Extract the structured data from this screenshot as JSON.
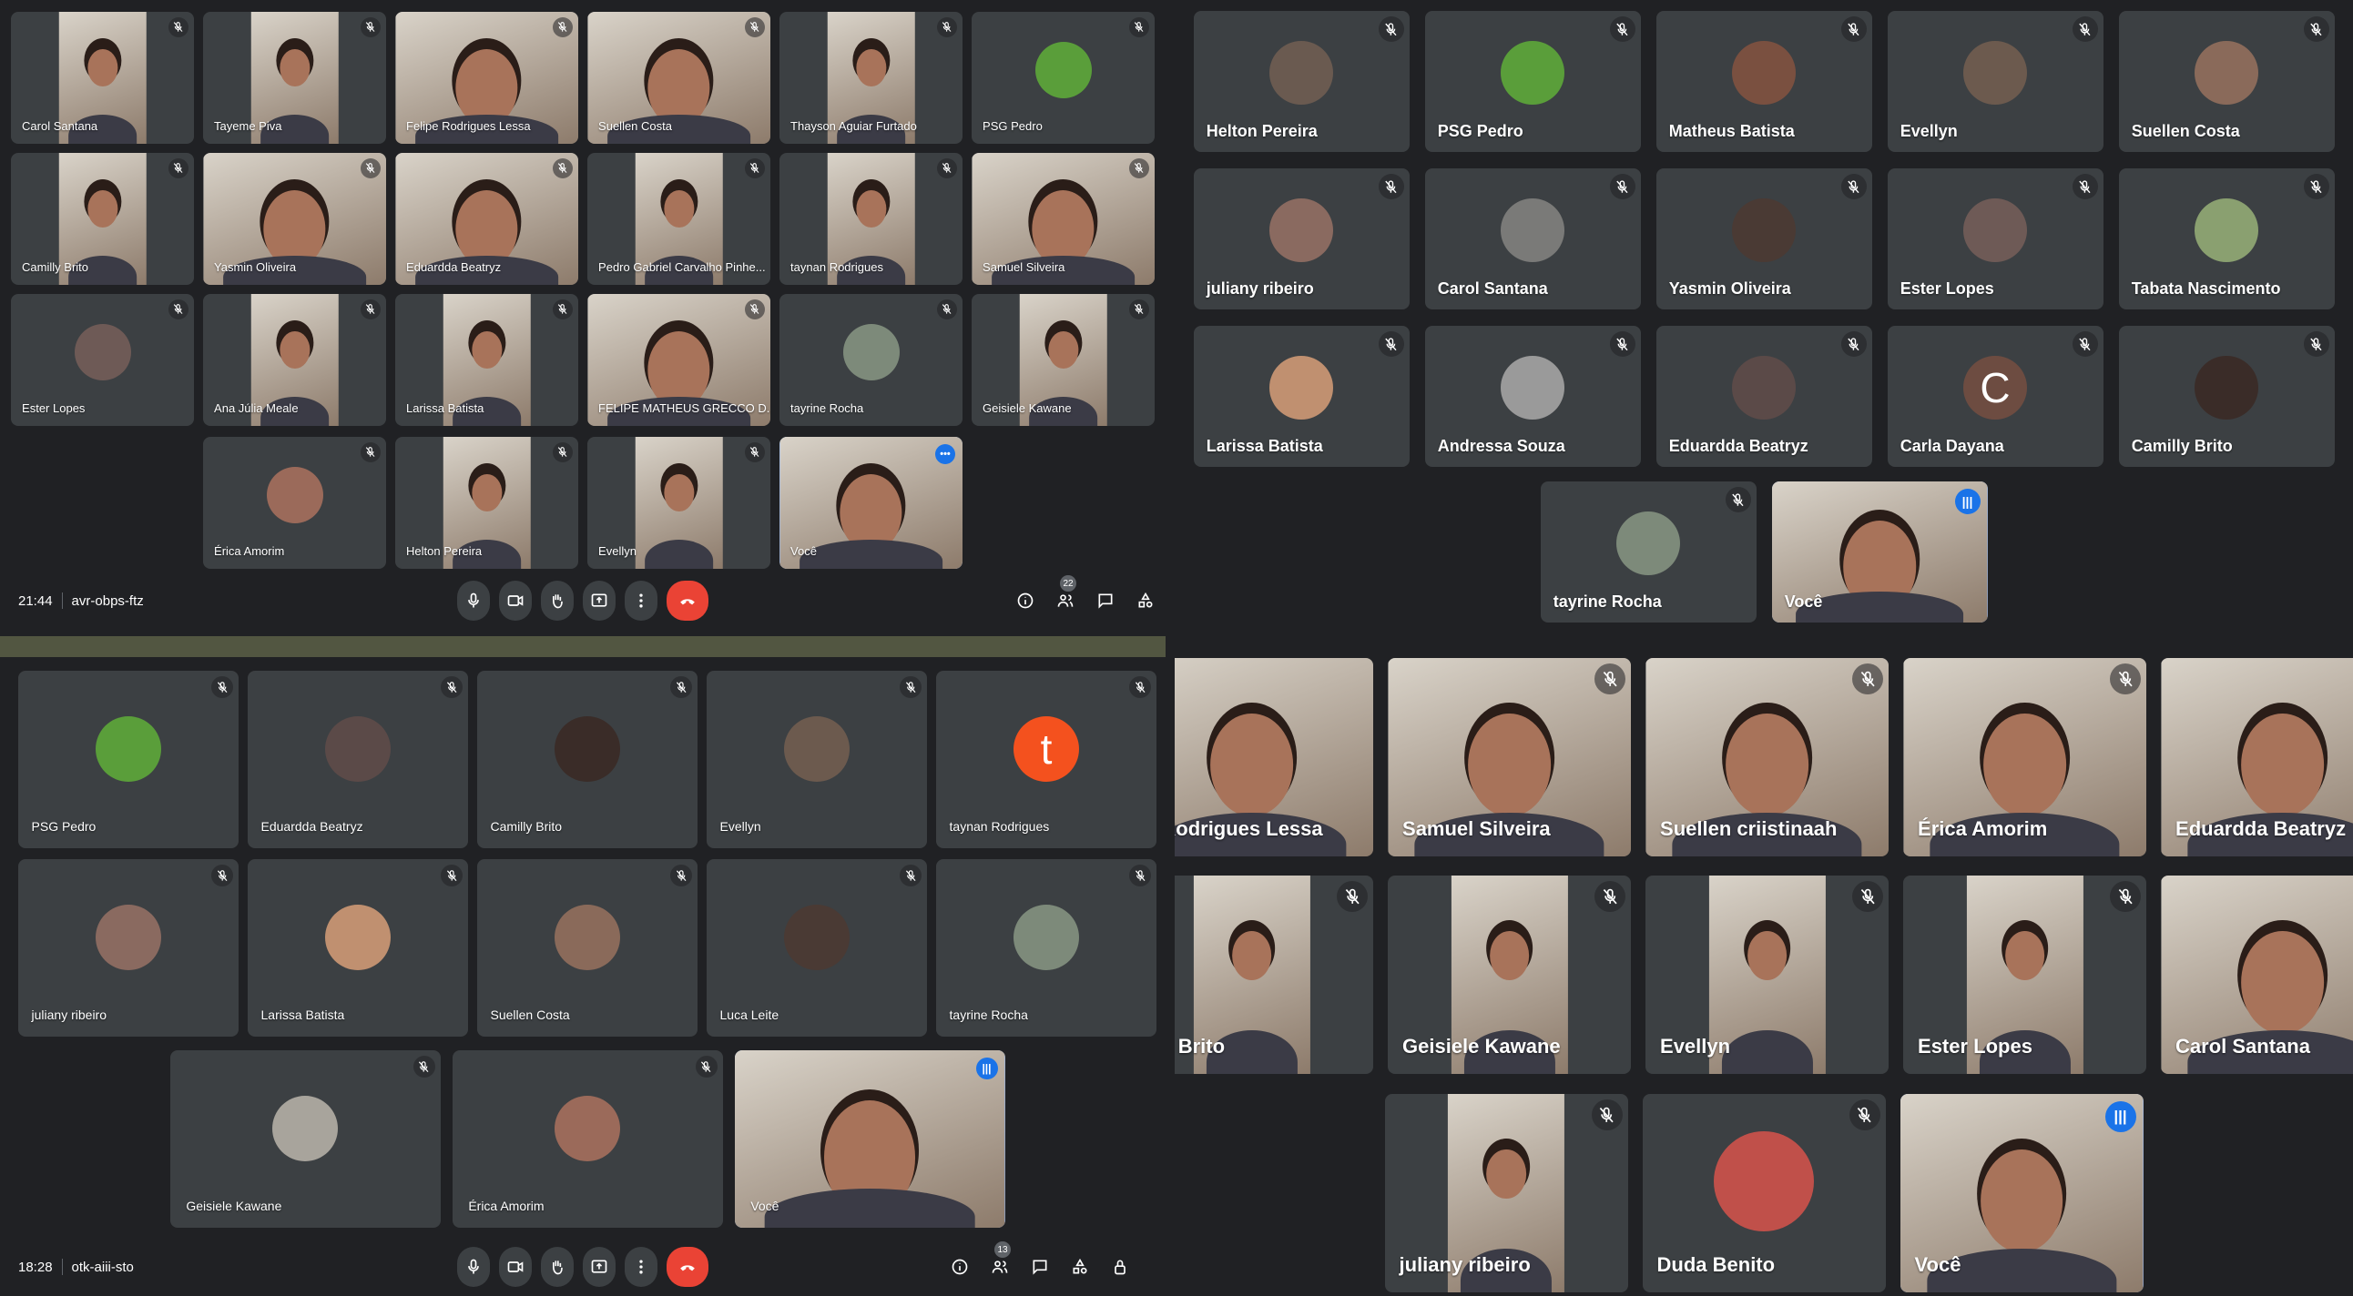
{
  "colors": {
    "tile_bg": "#3c4043",
    "page_bg": "#202124",
    "self_border": "#8ab4f8",
    "speaking": "#1a73e8",
    "end_call": "#ea4335",
    "divider": "#525641"
  },
  "meetings": [
    {
      "time": "21:44",
      "code": "avr-obps-ftz",
      "participant_count": "22",
      "rows": [
        [
          {
            "name": "Carol Santana",
            "type": "video"
          },
          {
            "name": "Tayeme Piva",
            "type": "video"
          },
          {
            "name": "Felipe Rodrigues Lessa",
            "type": "video",
            "full": true
          },
          {
            "name": "Suellen Costa",
            "type": "video",
            "full": true
          },
          {
            "name": "Thayson Aguiar Furtado",
            "type": "video"
          },
          {
            "name": "PSG Pedro",
            "type": "avatar",
            "color": "#5a9e3a"
          }
        ],
        [
          {
            "name": "Camilly Brito",
            "type": "video"
          },
          {
            "name": "Yasmin Oliveira",
            "type": "video",
            "full": true
          },
          {
            "name": "Eduardda Beatryz",
            "type": "video",
            "full": true
          },
          {
            "name": "Pedro Gabriel Carvalho Pinhe...",
            "type": "video"
          },
          {
            "name": "taynan Rodrigues",
            "type": "video"
          },
          {
            "name": "Samuel Silveira",
            "type": "video",
            "full": true
          }
        ],
        [
          {
            "name": "Ester Lopes",
            "type": "avatar",
            "color": "#6e5a56"
          },
          {
            "name": "Ana Júlia Meale",
            "type": "video"
          },
          {
            "name": "Larissa Batista",
            "type": "video"
          },
          {
            "name": "FELIPE MATHEUS GRECCO D...",
            "type": "video",
            "full": true
          },
          {
            "name": "tayrine Rocha",
            "type": "avatar",
            "color": "#7d8a7a"
          },
          {
            "name": "Geisiele Kawane",
            "type": "video"
          }
        ],
        [
          {
            "name": "Érica Amorim",
            "type": "avatar",
            "color": "#9b6a5a"
          },
          {
            "name": "Helton Pereira",
            "type": "video"
          },
          {
            "name": "Evellyn",
            "type": "video"
          },
          {
            "name": "Você",
            "type": "video",
            "full": true,
            "self": true,
            "indicator": "more"
          }
        ]
      ]
    },
    {
      "time": "18:28",
      "code": "otk-aiii-sto",
      "participant_count": "13",
      "rows": [
        [
          {
            "name": "PSG Pedro",
            "type": "avatar",
            "color": "#5a9e3a"
          },
          {
            "name": "Eduardda Beatryz",
            "type": "avatar",
            "color": "#5b4a48"
          },
          {
            "name": "Camilly Brito",
            "type": "avatar",
            "color": "#3a2c28"
          },
          {
            "name": "Evellyn",
            "type": "avatar",
            "color": "#6c5a4e"
          },
          {
            "name": "taynan Rodrigues",
            "type": "letter",
            "letter": "t",
            "color": "#f4511e"
          }
        ],
        [
          {
            "name": "juliany ribeiro",
            "type": "avatar",
            "color": "#8a6a60"
          },
          {
            "name": "Larissa Batista",
            "type": "avatar",
            "color": "#c09070"
          },
          {
            "name": "Suellen Costa",
            "type": "avatar",
            "color": "#8a6a5a"
          },
          {
            "name": "Luca Leite",
            "type": "avatar",
            "color": "#4a3a34"
          },
          {
            "name": "tayrine Rocha",
            "type": "avatar",
            "color": "#7d8a7a"
          }
        ],
        [
          {
            "name": "Geisiele Kawane",
            "type": "avatar",
            "color": "#a8a49c"
          },
          {
            "name": "Érica Amorim",
            "type": "avatar",
            "color": "#9b6a5a"
          },
          {
            "name": "Você",
            "type": "video",
            "full": true,
            "self": true,
            "indicator": "speaking"
          }
        ]
      ]
    },
    {
      "rows": [
        [
          {
            "name": "Helton Pereira",
            "type": "avatar",
            "color": "#6a5a50"
          },
          {
            "name": "PSG Pedro",
            "type": "avatar",
            "color": "#5a9e3a"
          },
          {
            "name": "Matheus Batista",
            "type": "avatar",
            "color": "#7a5040"
          },
          {
            "name": "Evellyn",
            "type": "avatar",
            "color": "#6c5a4e"
          },
          {
            "name": "Suellen Costa",
            "type": "avatar",
            "color": "#8a6a5a"
          }
        ],
        [
          {
            "name": "juliany ribeiro",
            "type": "avatar",
            "color": "#8a6a60"
          },
          {
            "name": "Carol Santana",
            "type": "avatar",
            "color": "#7a7a78"
          },
          {
            "name": "Yasmin Oliveira",
            "type": "avatar",
            "color": "#4a3a34"
          },
          {
            "name": "Ester Lopes",
            "type": "avatar",
            "color": "#6e5a56"
          },
          {
            "name": "Tabata Nascimento",
            "type": "avatar",
            "color": "#8aa070"
          }
        ],
        [
          {
            "name": "Larissa Batista",
            "type": "avatar",
            "color": "#c09070"
          },
          {
            "name": "Andressa Souza",
            "type": "avatar",
            "color": "#9a9a9a"
          },
          {
            "name": "Eduardda Beatryz",
            "type": "avatar",
            "color": "#5b4a48"
          },
          {
            "name": "Carla Dayana",
            "type": "letter",
            "letter": "C",
            "color": "#6d4c41"
          },
          {
            "name": "Camilly Brito",
            "type": "avatar",
            "color": "#3a2c28"
          }
        ],
        [
          {
            "name": "tayrine Rocha",
            "type": "avatar",
            "color": "#7d8a7a"
          },
          {
            "name": "Você",
            "type": "video",
            "full": true,
            "self": true,
            "indicator": "speaking"
          }
        ]
      ]
    },
    {
      "rows": [
        [
          {
            "name": "e Rodrigues Lessa",
            "type": "video",
            "full": true,
            "unmuted": true
          },
          {
            "name": "Samuel Silveira",
            "type": "video",
            "full": true
          },
          {
            "name": "Suellen criistinaah",
            "type": "video",
            "full": true
          },
          {
            "name": "Érica Amorim",
            "type": "video",
            "full": true
          },
          {
            "name": "Eduardda Beatryz",
            "type": "video",
            "full": true,
            "unmuted": true
          }
        ],
        [
          {
            "name": "illy Brito",
            "type": "video"
          },
          {
            "name": "Geisiele Kawane",
            "type": "video"
          },
          {
            "name": "Evellyn",
            "type": "video"
          },
          {
            "name": "Ester Lopes",
            "type": "video"
          },
          {
            "name": "Carol Santana",
            "type": "video",
            "full": true,
            "unmuted": true
          }
        ],
        [
          {
            "name": "juliany ribeiro",
            "type": "video"
          },
          {
            "name": "Duda Benito",
            "type": "avatar",
            "color": "#c0504a"
          },
          {
            "name": "Você",
            "type": "video",
            "full": true,
            "self": true,
            "indicator": "speaking"
          }
        ]
      ]
    }
  ]
}
